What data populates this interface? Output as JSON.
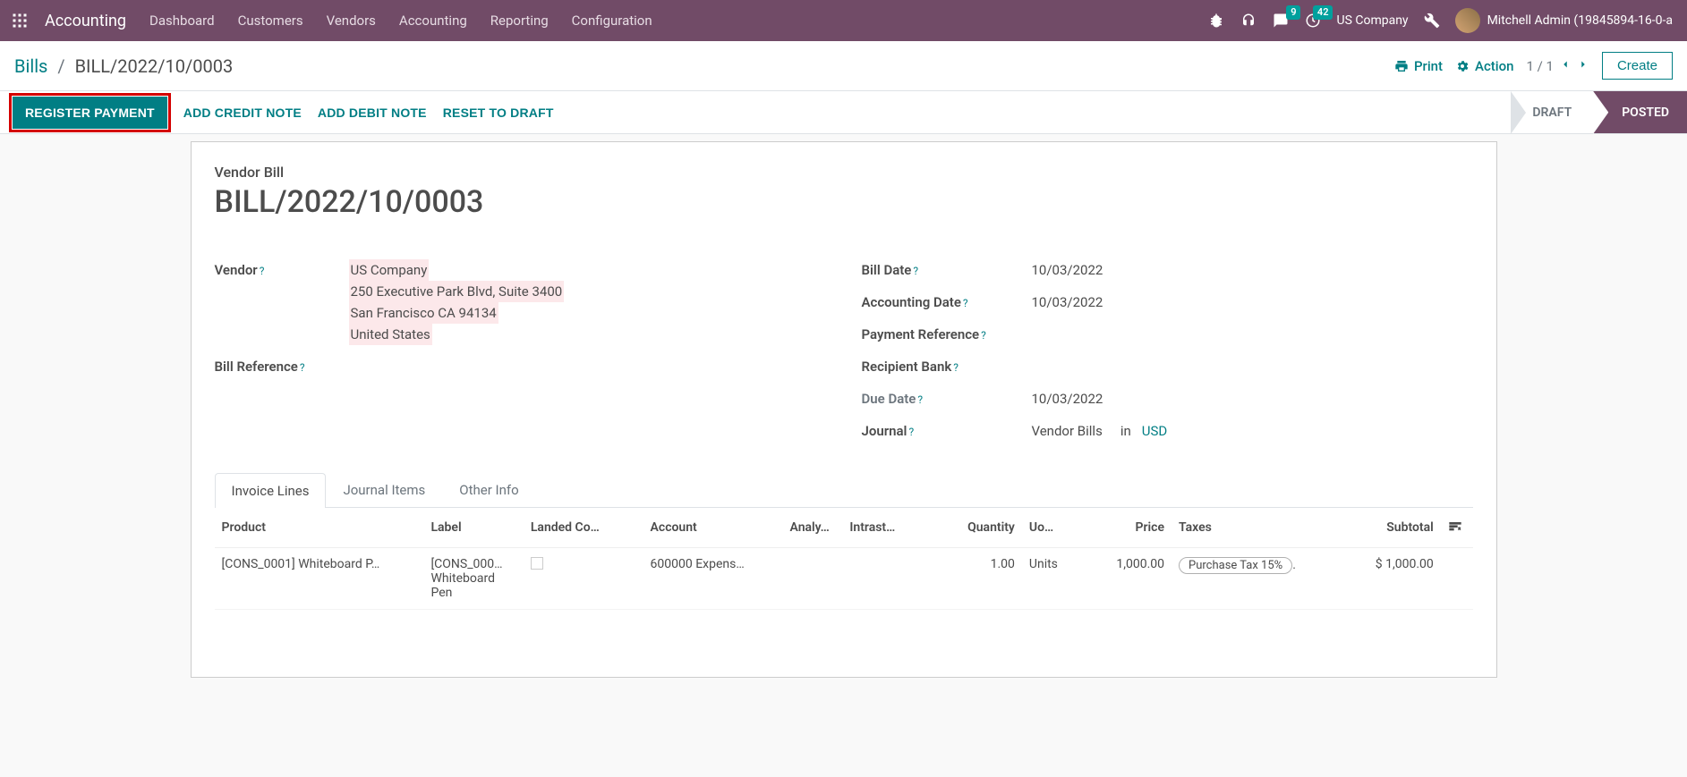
{
  "topnav": {
    "brand": "Accounting",
    "menu": [
      "Dashboard",
      "Customers",
      "Vendors",
      "Accounting",
      "Reporting",
      "Configuration"
    ],
    "msg_badge": "9",
    "clock_badge": "42",
    "company": "US Company",
    "user": "Mitchell Admin (19845894-16-0-a"
  },
  "controlbar": {
    "root": "Bills",
    "current": "BILL/2022/10/0003",
    "print": "Print",
    "action": "Action",
    "pager": "1 / 1",
    "create": "Create"
  },
  "statusbar": {
    "register_payment": "REGISTER PAYMENT",
    "add_credit": "ADD CREDIT NOTE",
    "add_debit": "ADD DEBIT NOTE",
    "reset_draft": "RESET TO DRAFT",
    "draft": "DRAFT",
    "posted": "POSTED"
  },
  "form": {
    "subtitle": "Vendor Bill",
    "title": "BILL/2022/10/0003",
    "labels": {
      "vendor": "Vendor",
      "bill_ref": "Bill Reference",
      "bill_date": "Bill Date",
      "acc_date": "Accounting Date",
      "pay_ref": "Payment Reference",
      "recip_bank": "Recipient Bank",
      "due_date": "Due Date",
      "journal": "Journal",
      "in": "in"
    },
    "vendor": {
      "name": "US Company",
      "line1": "250 Executive Park Blvd, Suite 3400",
      "line2": "San Francisco CA 94134",
      "line3": "United States"
    },
    "bill_date": "10/03/2022",
    "acc_date": "10/03/2022",
    "pay_ref": "",
    "recip_bank": "",
    "due_date": "10/03/2022",
    "journal": "Vendor Bills",
    "currency": "USD"
  },
  "tabs": [
    "Invoice Lines",
    "Journal Items",
    "Other Info"
  ],
  "table": {
    "headers": {
      "product": "Product",
      "label": "Label",
      "landed": "Landed Co…",
      "account": "Account",
      "analy": "Analy…",
      "intrast": "Intrast…",
      "qty": "Quantity",
      "uom": "Uo…",
      "price": "Price",
      "taxes": "Taxes",
      "subtotal": "Subtotal"
    },
    "row": {
      "product": "[CONS_0001] Whiteboard P…",
      "label": "[CONS_000… Whiteboard Pen",
      "account": "600000 Expens…",
      "qty": "1.00",
      "uom": "Units",
      "price": "1,000.00",
      "tax": "Purchase Tax 15%",
      "tax_suffix": ".",
      "subtotal": "$ 1,000.00"
    }
  }
}
